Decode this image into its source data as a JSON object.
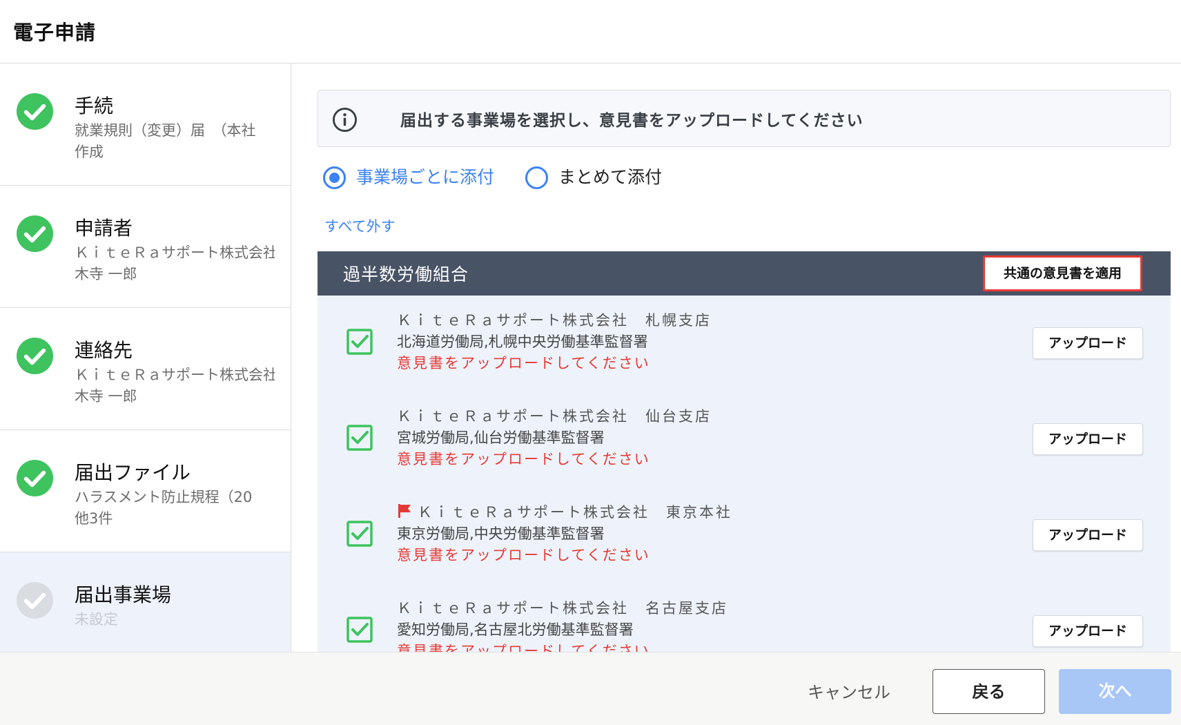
{
  "app": {
    "title": "電子申請"
  },
  "colors": {
    "accent": "#3b82f6",
    "success": "#3ec35e",
    "error": "#e53935",
    "group_header": "#495366",
    "disabled": "#a8c7f7"
  },
  "sidebar": {
    "steps": [
      {
        "title": "手続",
        "sub1": "就業規則（変更）届　（本社",
        "sub2": "作成",
        "status": "done"
      },
      {
        "title": "申請者",
        "sub1": "ＫｉｔｅＲａサポート株式会社",
        "sub2": "木寺 一郎",
        "status": "done"
      },
      {
        "title": "連絡先",
        "sub1": "ＫｉｔｅＲａサポート株式会社",
        "sub2": "木寺 一郎",
        "status": "done"
      },
      {
        "title": "届出ファイル",
        "sub1": "ハラスメント防止規程（20",
        "sub2": "他3件",
        "status": "done"
      },
      {
        "title": "届出事業場",
        "sub1": "未設定",
        "sub2": "",
        "status": "pending"
      }
    ]
  },
  "main": {
    "info_text": "届出する事業場を選択し、意見書をアップロードしてください",
    "radio": {
      "options": [
        {
          "label": "事業場ごとに添付",
          "selected": true
        },
        {
          "label": "まとめて添付",
          "selected": false
        }
      ]
    },
    "clear_all_label": "すべて外す",
    "group": {
      "name": "過半数労働組合",
      "apply_common_label": "共通の意見書を適用"
    },
    "offices": [
      {
        "name": "ＫｉｔｅＲａサポート株式会社　札幌支店",
        "bureau": "北海道労働局,札幌中央労働基準監督署",
        "warning": "意見書をアップロードしてください",
        "checked": true,
        "head_office": false,
        "upload_label": "アップロード"
      },
      {
        "name": "ＫｉｔｅＲａサポート株式会社　仙台支店",
        "bureau": "宮城労働局,仙台労働基準監督署",
        "warning": "意見書をアップロードしてください",
        "checked": true,
        "head_office": false,
        "upload_label": "アップロード"
      },
      {
        "name": "ＫｉｔｅＲａサポート株式会社　東京本社",
        "bureau": "東京労働局,中央労働基準監督署",
        "warning": "意見書をアップロードしてください",
        "checked": true,
        "head_office": true,
        "upload_label": "アップロード"
      },
      {
        "name": "ＫｉｔｅＲａサポート株式会社　名古屋支店",
        "bureau": "愛知労働局,名古屋北労働基準監督署",
        "warning": "意見書をアップロードしてください",
        "checked": true,
        "head_office": false,
        "upload_label": "アップロード"
      }
    ]
  },
  "footer": {
    "cancel_label": "キャンセル",
    "back_label": "戻る",
    "next_label": "次へ"
  }
}
